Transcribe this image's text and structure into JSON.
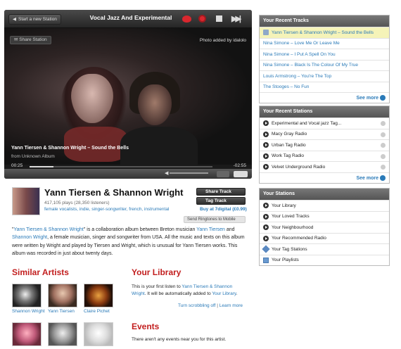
{
  "player": {
    "start_station": "Start a new Station",
    "station_title": "Vocal Jazz And Experimental",
    "share_station": "Share Station",
    "photo_credit": "Photo added by idalolo",
    "track": "Yann Tiersen & Shannon Wright – Sound the Bells",
    "album": "from Unknown Album",
    "elapsed": "00:25",
    "remaining": "-02:55",
    "progress_fraction": 0.13
  },
  "artist": {
    "name": "Yann Tiersen & Shannon Wright",
    "plays": "417,105 plays (28,350 listeners)",
    "tags": "female vocalists, indie, singer-songwriter, french, instrumental",
    "share_track": "Share Track",
    "tag_track": "Tag Track",
    "buy": "Buy at 7digital (£0.99)",
    "ringtone": "Send Ringtones to Mobile",
    "bio_link1": "Yann Tiersen & Shannon Wright",
    "bio_text1": " is a collaboration album between Breton musician ",
    "bio_link2": "Yann Tiersen",
    "bio_text2": " and ",
    "bio_link3": "Shannon Wright",
    "bio_text3": ", a female musician, singer and songwriter from USA. All the music and texts on this album were written by Wright and played by Tiersen and Wright, which is unusual for Yann Tiersen works. This album was recorded in just about twenty days."
  },
  "similar": {
    "heading": "Similar Artists",
    "names": [
      "Shannon Wright",
      "Yann Tiersen",
      "Claire Pichet"
    ]
  },
  "library": {
    "heading": "Your Library",
    "text1": "This is your first listen to ",
    "link1": "Yann Tiersen & Shannon Wright",
    "text2": ". It will be automatically added to ",
    "link2": "Your Library",
    "text3": ".",
    "scrobble_off": "Turn scrobbling off",
    "sep": " | ",
    "learn_more": "Learn more"
  },
  "events": {
    "heading": "Events",
    "text": "There aren't any events near you for this artist."
  },
  "recent_tracks": {
    "heading": "Your Recent Tracks",
    "items": [
      "Yann Tiersen & Shannon Wright – Sound the Bells",
      "Nina Simone – Love Me Or Leave Me",
      "Nina Simone – I Put A Spell On You",
      "Nina Simone – Black Is The Colour Of My True",
      "Louis Armstrong – You're The Top",
      "The Stooges – No Fun"
    ],
    "see_more": "See more"
  },
  "recent_stations": {
    "heading": "Your Recent Stations",
    "items": [
      "Experimental and Vocal jazz Tag...",
      "Macy Gray Radio",
      "Urban Tag Radio",
      "Work Tag Radio",
      "Velvet Underground Radio"
    ],
    "see_more": "See more"
  },
  "stations": {
    "heading": "Your Stations",
    "items": [
      "Your Library",
      "Your Loved Tracks",
      "Your Neighbourhood",
      "Your Recommended Radio",
      "Your Tag Stations",
      "Your Playlists"
    ]
  },
  "colors": {
    "accent_red": "#c21e1e",
    "link_blue": "#2a7ab8",
    "highlight": "#f5f3b8"
  }
}
